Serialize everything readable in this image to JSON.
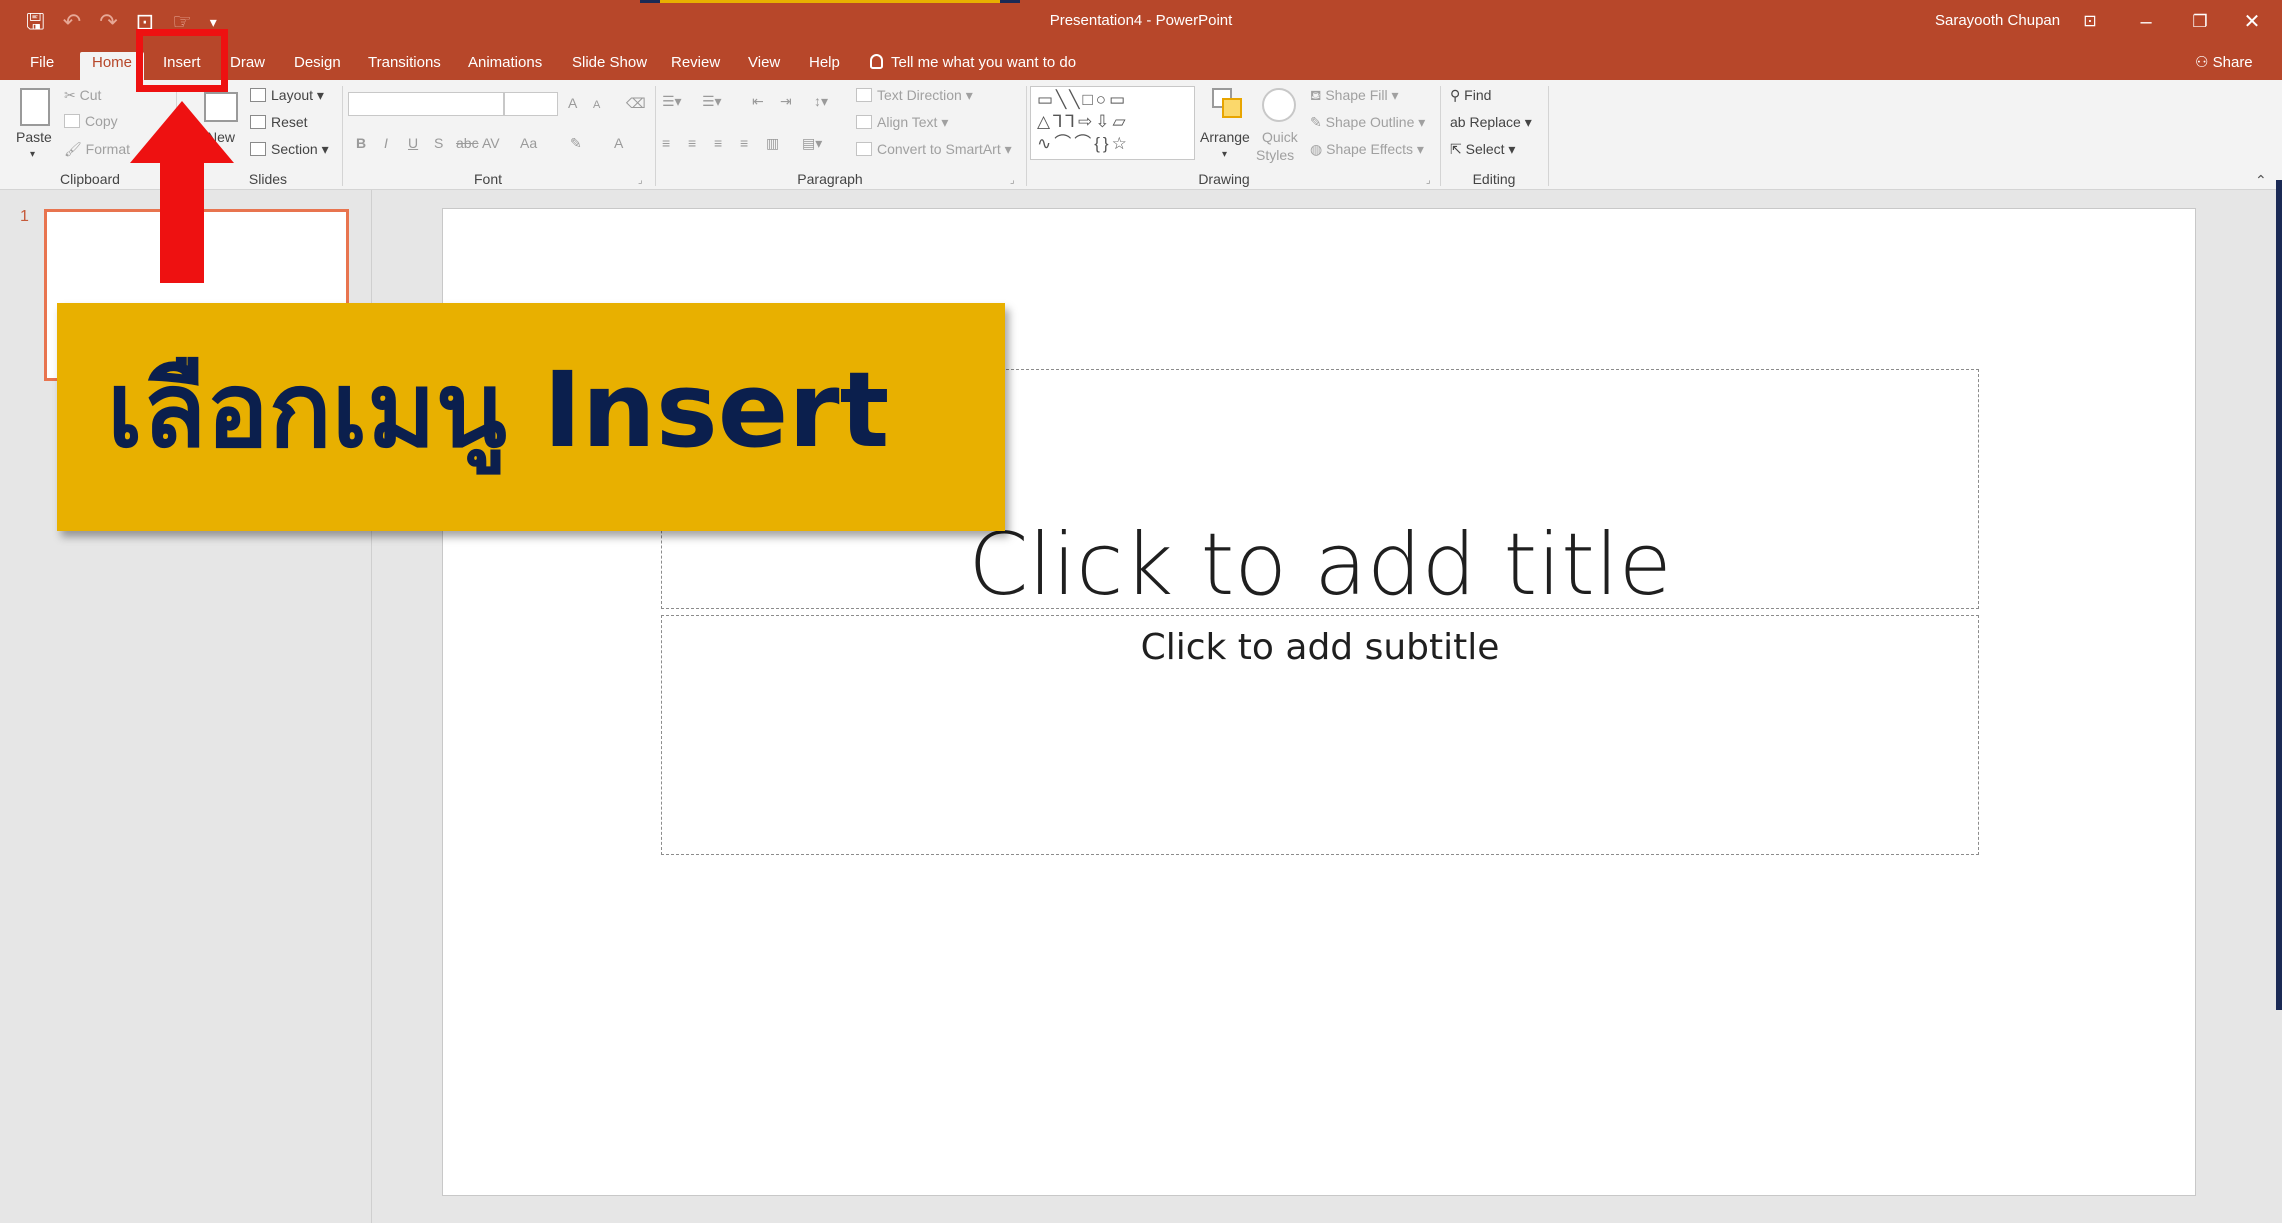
{
  "titlebar": {
    "document_title": "Presentation4 - PowerPoint",
    "user_name": "Sarayooth Chupan",
    "quick_access": {
      "save_icon": "save-icon",
      "undo_icon": "undo-icon",
      "redo_icon": "redo-icon",
      "start_slideshow_icon": "slideshow-icon",
      "customize_icon": "customize-qat-icon"
    },
    "window_controls": {
      "ribbon_display": "ribbon-display-icon",
      "minimize": "minimize-icon",
      "restore": "restore-icon",
      "close": "close-icon"
    }
  },
  "tabs": [
    {
      "label": "File"
    },
    {
      "label": "Home",
      "active": true
    },
    {
      "label": "Insert"
    },
    {
      "label": "Draw"
    },
    {
      "label": "Design"
    },
    {
      "label": "Transitions"
    },
    {
      "label": "Animations"
    },
    {
      "label": "Slide Show"
    },
    {
      "label": "Review"
    },
    {
      "label": "View"
    },
    {
      "label": "Help"
    }
  ],
  "tell_me": "Tell me what you want to do",
  "share": "Share",
  "ribbon": {
    "clipboard": {
      "label": "Clipboard",
      "paste": "Paste",
      "cut": "Cut",
      "copy": "Copy",
      "format_painter": "Format"
    },
    "slides": {
      "label": "Slides",
      "new_slide": "New",
      "layout": "Layout",
      "reset": "Reset",
      "section": "Section"
    },
    "font": {
      "label": "Font",
      "bold": "B",
      "italic": "I",
      "underline": "U",
      "shadow": "S",
      "strikethrough": "abc",
      "spacing": "AV",
      "case": "Aa",
      "grow": "A",
      "shrink": "A",
      "color": "A"
    },
    "paragraph": {
      "label": "Paragraph",
      "text_direction": "Text Direction",
      "align_text": "Align Text",
      "convert_smartart": "Convert to SmartArt"
    },
    "drawing": {
      "label": "Drawing",
      "shapes_preview": "▭╲╲□○▭ △⅂⅂⇨⇩▱ ∿⌒⌒{}☆",
      "arrange": "Arrange",
      "quick_styles_1": "Quick",
      "quick_styles_2": "Styles",
      "shape_fill": "Shape Fill",
      "shape_outline": "Shape Outline",
      "shape_effects": "Shape Effects"
    },
    "editing": {
      "label": "Editing",
      "find": "Find",
      "replace": "Replace",
      "select": "Select"
    }
  },
  "thumbnail": {
    "number": "1"
  },
  "slide": {
    "title_placeholder": "Click to add title",
    "subtitle_placeholder": "Click to add subtitle"
  },
  "overlay": {
    "banner_text": "เลือกเมนู Insert"
  },
  "colors": {
    "accent": "#b7472a",
    "banner": "#e8b000",
    "banner_text": "#0b1f4d",
    "highlight": "#ee1111"
  }
}
